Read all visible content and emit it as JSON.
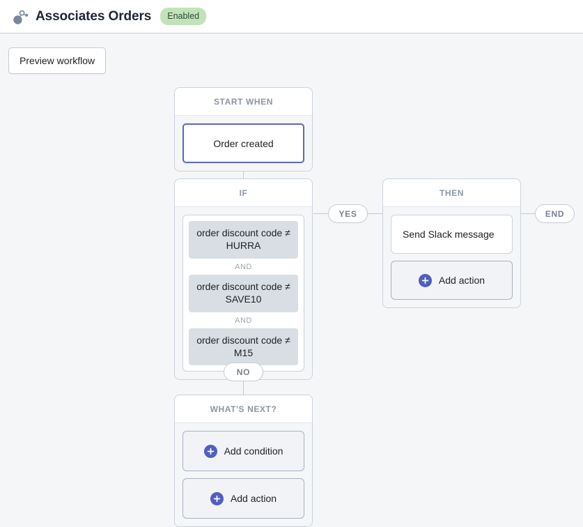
{
  "header": {
    "icon": "workflow-graph-icon",
    "title": "Associates Orders",
    "status": "Enabled",
    "status_color": "#c2e3ba"
  },
  "toolbar": {
    "preview_label": "Preview workflow"
  },
  "canvas": {
    "accent_color": "#5a66c4",
    "connector_color": "#c3cad4",
    "nodes": {
      "trigger": {
        "header": "START WHEN",
        "item": "Order created"
      },
      "condition": {
        "header": "IF",
        "conditions": [
          "order discount code ≠ HURRA",
          "order discount code ≠ SAVE10",
          "order discount code ≠ M15"
        ],
        "operators": [
          "AND",
          "AND"
        ]
      },
      "then": {
        "header": "THEN",
        "action": "Send Slack message",
        "add_action_label": "Add action"
      },
      "whats_next": {
        "header": "WHAT'S NEXT?",
        "add_condition_label": "Add condition",
        "add_action_label": "Add action"
      }
    },
    "pills": {
      "yes": "YES",
      "no": "NO",
      "end": "END"
    }
  }
}
